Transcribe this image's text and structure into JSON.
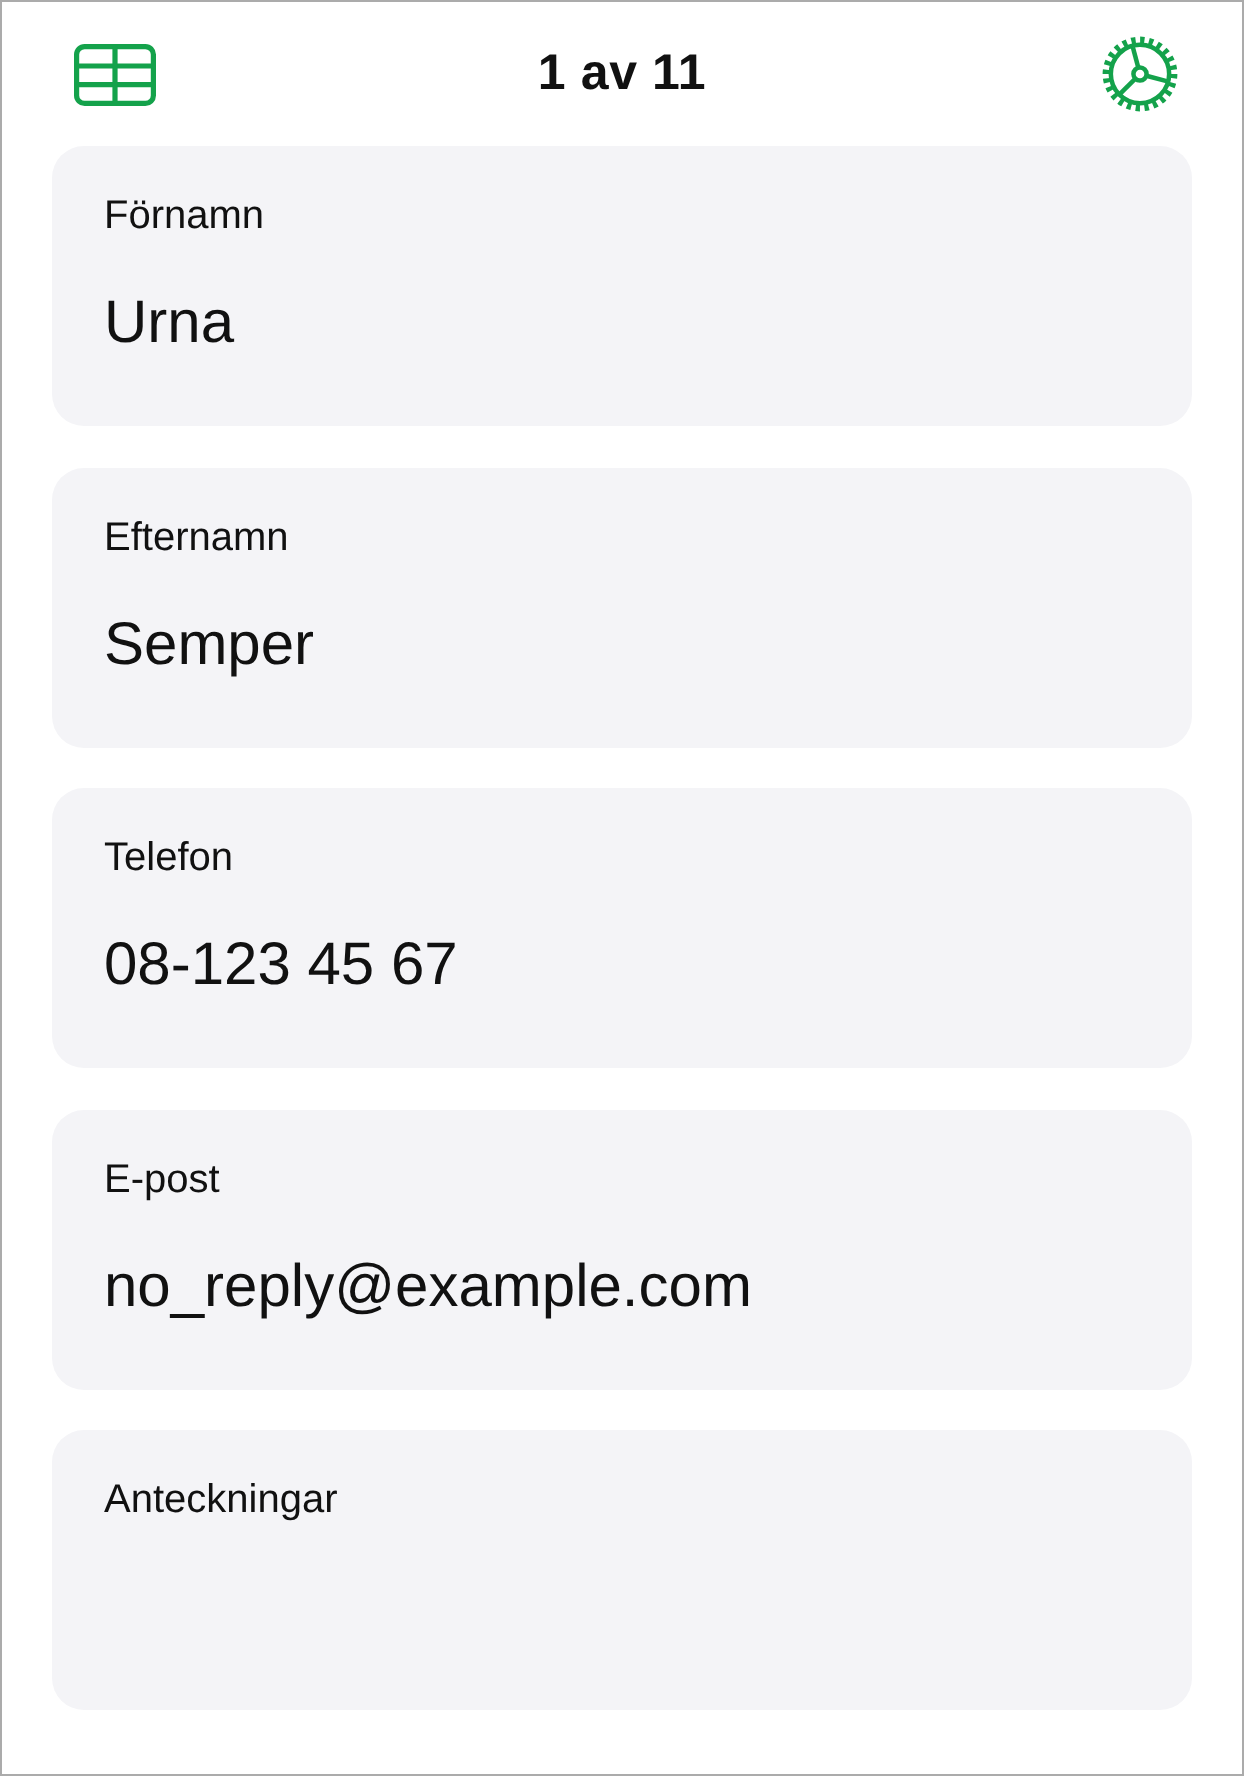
{
  "toolbar": {
    "title": "1 av 11"
  },
  "fields": [
    {
      "kind": "text",
      "label": "Förnamn",
      "value": "Urna"
    },
    {
      "kind": "text",
      "label": "Efternamn",
      "value": "Semper"
    },
    {
      "kind": "text",
      "label": "Telefon",
      "value": "08-123 45 67"
    },
    {
      "kind": "text",
      "label": "E-post",
      "value": "no_reply@example.com"
    },
    {
      "kind": "notes",
      "label": "Anteckningar"
    }
  ]
}
